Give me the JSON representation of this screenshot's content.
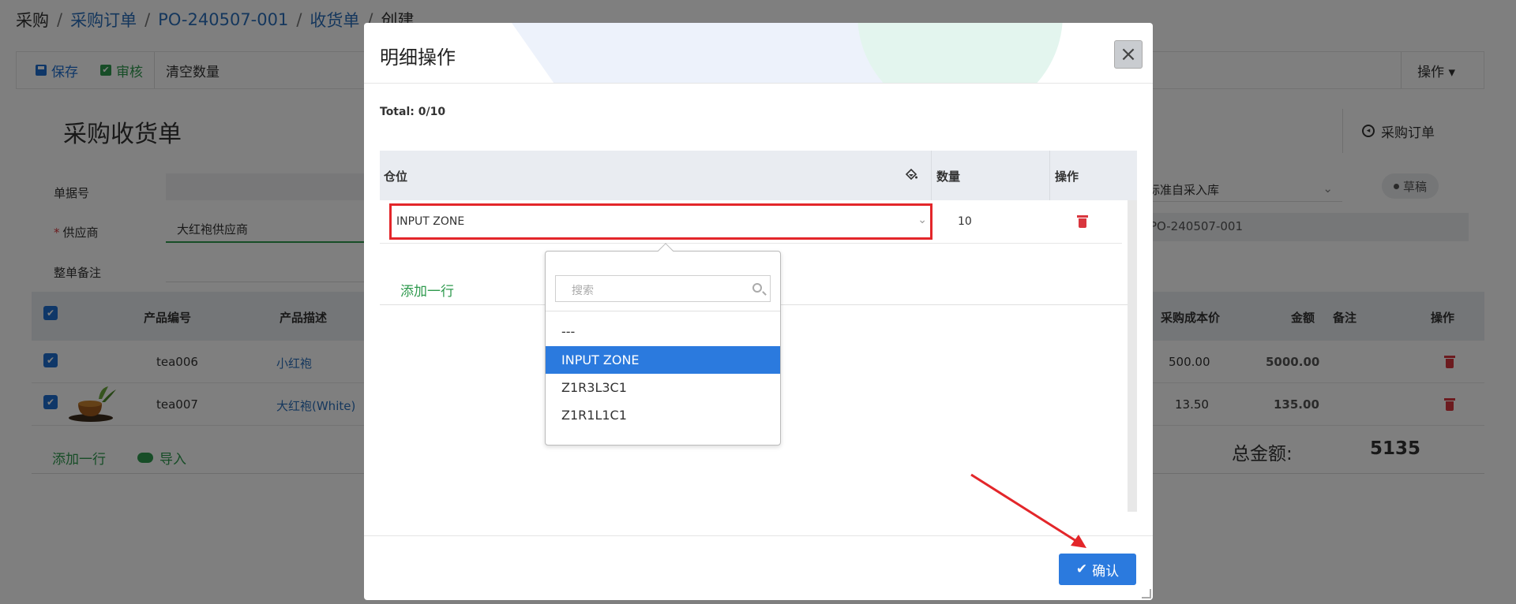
{
  "breadcrumb": {
    "items": [
      "采购",
      "采购订单",
      "PO-240507-001",
      "收货单",
      "创建"
    ],
    "separator": "/"
  },
  "toolbar": {
    "save_label": "保存",
    "audit_label": "审核",
    "clear_label": "清空数量",
    "actions_label": "操作 ▾"
  },
  "form": {
    "title": "采购收货单",
    "doc_no_label": "单据号",
    "supplier_label": "供应商",
    "supplier_required": "*",
    "supplier_value": "大红袍供应商",
    "note_label": "整单备注",
    "po_link_label": "采购订单",
    "warehouse_value": "标准自采入库",
    "status_badge": "草稿",
    "po_ref": "PO-240507-001"
  },
  "table": {
    "headers": {
      "code": "产品编号",
      "desc": "产品描述",
      "cost": "采购成本价",
      "amount": "金额",
      "note": "备注",
      "ops": "操作"
    },
    "rows": [
      {
        "code": "tea006",
        "desc": "小红袍",
        "cost": "500.00",
        "amount": "5000.00"
      },
      {
        "code": "tea007",
        "desc": "大红袍(White)",
        "cost": "13.50",
        "amount": "135.00"
      }
    ],
    "add_row": "添加一行",
    "import": "导入",
    "total_label": "总金额:",
    "total_value": "5135"
  },
  "modal": {
    "title": "明细操作",
    "total": "Total: 0/10",
    "col_location": "仓位",
    "col_qty": "数量",
    "col_ops": "操作",
    "row": {
      "location": "INPUT ZONE",
      "qty": "10"
    },
    "add_row": "添加一行",
    "confirm_label": "确认"
  },
  "dropdown": {
    "search_placeholder": "搜索",
    "options": [
      "---",
      "INPUT ZONE",
      "Z1R3L3C1",
      "Z1R1L1C1"
    ],
    "selected": "INPUT ZONE"
  },
  "colors": {
    "primary": "#2b7ade",
    "success": "#2f9a4e",
    "danger": "#d9363e",
    "highlight_border": "#e3262a"
  }
}
